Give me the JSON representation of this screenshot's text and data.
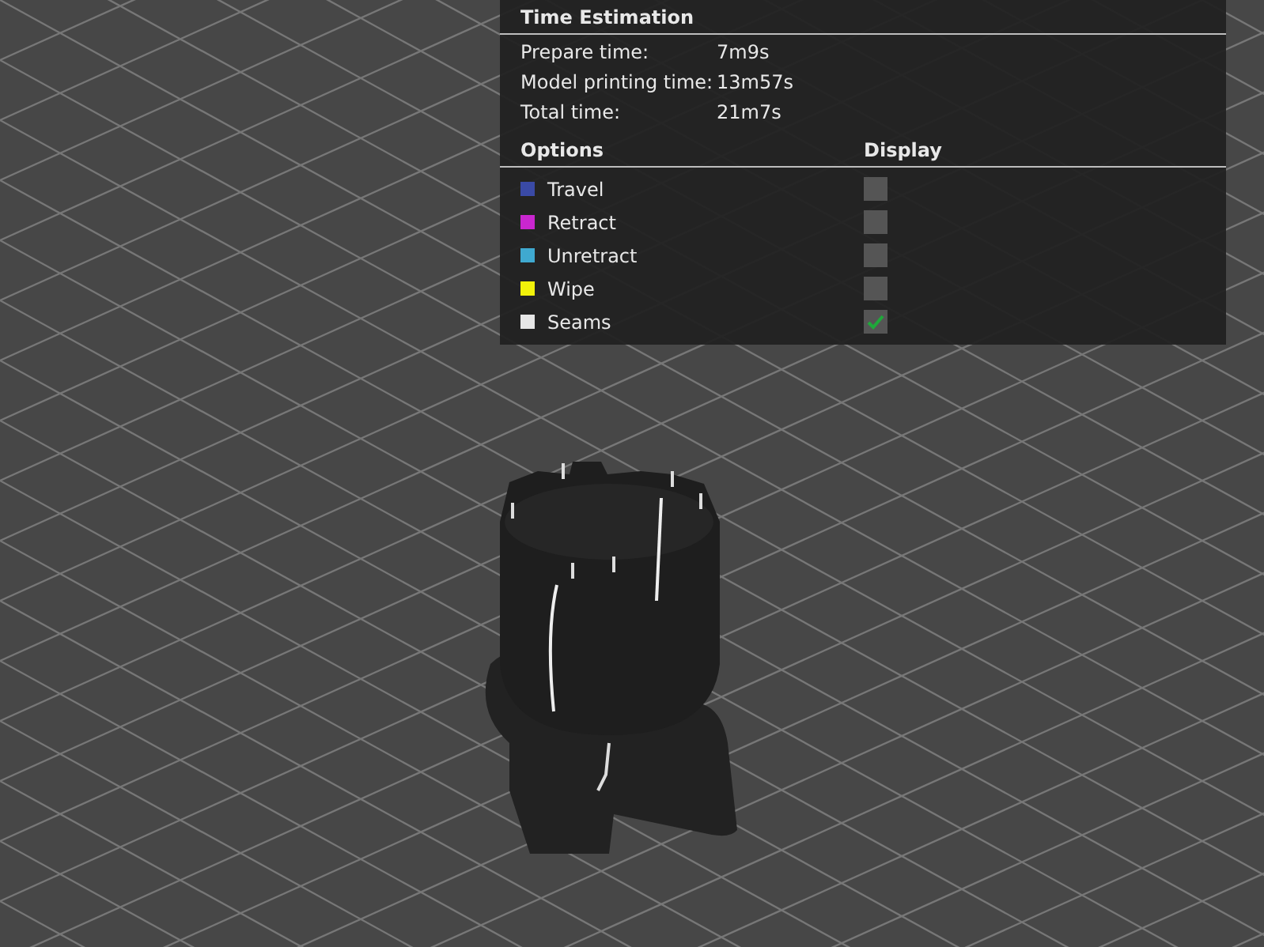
{
  "time_estimation": {
    "title": "Time Estimation",
    "rows": [
      {
        "label": "Prepare time:",
        "value": "7m9s"
      },
      {
        "label": "Model printing time:",
        "value": "13m57s"
      },
      {
        "label": "Total time:",
        "value": "21m7s"
      }
    ]
  },
  "options": {
    "columns": [
      "Options",
      "Display"
    ],
    "items": [
      {
        "label": "Travel",
        "color": "#3a4aa6",
        "checked": false
      },
      {
        "label": "Retract",
        "color": "#c926cf",
        "checked": false
      },
      {
        "label": "Unretract",
        "color": "#3fa9d0",
        "checked": false
      },
      {
        "label": "Wipe",
        "color": "#f2f20a",
        "checked": false
      },
      {
        "label": "Seams",
        "color": "#e6e6e6",
        "checked": true
      }
    ]
  }
}
